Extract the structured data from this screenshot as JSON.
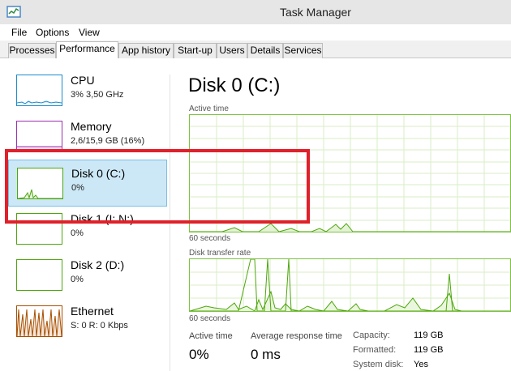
{
  "window": {
    "title": "Task Manager"
  },
  "menu": [
    "File",
    "Options",
    "View"
  ],
  "tabs": [
    "Processes",
    "Performance",
    "App history",
    "Start-up",
    "Users",
    "Details",
    "Services"
  ],
  "sidebar": [
    {
      "name": "CPU",
      "sub": "3% 3,50 GHz"
    },
    {
      "name": "Memory",
      "sub": "2,6/15,9 GB (16%)"
    },
    {
      "name": "Disk 0 (C:)",
      "sub": "0%"
    },
    {
      "name": "Disk 1 (I: N:)",
      "sub": "0%"
    },
    {
      "name": "Disk 2 (D:)",
      "sub": "0%"
    },
    {
      "name": "Ethernet",
      "sub": "S: 0 R: 0 Kbps"
    }
  ],
  "main": {
    "title": "Disk 0 (C:)",
    "active_time_label": "Active time",
    "seconds_label_1": "60 seconds",
    "transfer_label": "Disk transfer rate",
    "seconds_label_2": "60 seconds"
  },
  "stats": {
    "active_time_label": "Active time",
    "active_time_value": "0%",
    "response_label": "Average response time",
    "response_value": "0 ms"
  },
  "props": [
    {
      "label": "Capacity:",
      "value": "119 GB"
    },
    {
      "label": "Formatted:",
      "value": "119 GB"
    },
    {
      "label": "System disk:",
      "value": "Yes"
    }
  ],
  "colors": {
    "cpu": "#1a8ccd",
    "memory": "#9b2fae",
    "disk": "#4da60c",
    "ethernet": "#a74f01",
    "selection": "#cce8f6",
    "highlight": "#e0202a"
  }
}
